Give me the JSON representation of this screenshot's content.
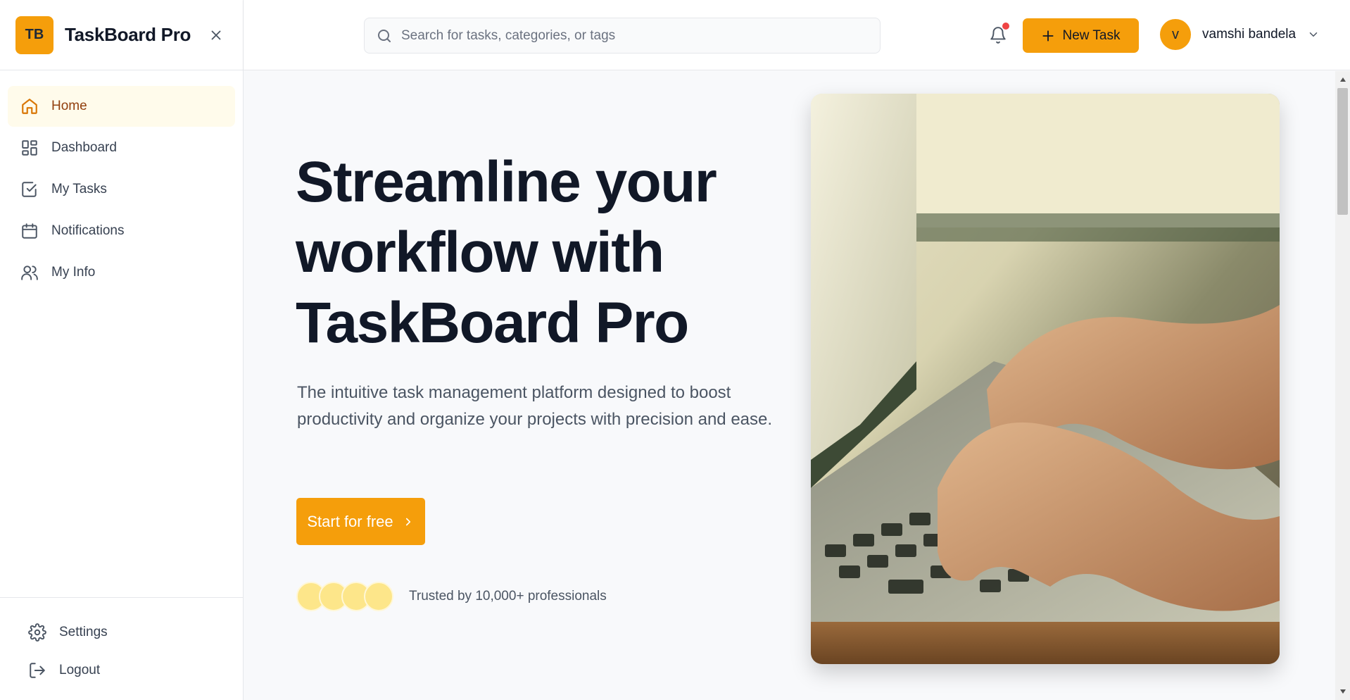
{
  "brand": {
    "logo_text": "TB",
    "name": "TaskBoard Pro"
  },
  "sidebar": {
    "items": [
      {
        "label": "Home",
        "icon": "home-icon",
        "active": true
      },
      {
        "label": "Dashboard",
        "icon": "dashboard-icon"
      },
      {
        "label": "My Tasks",
        "icon": "check-square-icon"
      },
      {
        "label": "Notifications",
        "icon": "calendar-icon"
      },
      {
        "label": "My Info",
        "icon": "users-icon"
      }
    ],
    "bottom": [
      {
        "label": "Settings",
        "icon": "gear-icon"
      },
      {
        "label": "Logout",
        "icon": "logout-icon"
      }
    ]
  },
  "header": {
    "search_placeholder": "Search for tasks, categories, or tags",
    "new_task_label": "New Task",
    "user": {
      "initial": "v",
      "name": "vamshi bandela"
    }
  },
  "hero": {
    "title": "Streamline your workflow with TaskBoard Pro",
    "subtitle": "The intuitive task management platform designed to boost productivity and organize your projects with precision and ease.",
    "cta_label": "Start for free",
    "trust_text": "Trusted by 10,000+ professionals"
  },
  "colors": {
    "accent": "#f59e0b",
    "active_bg": "#fffbeb",
    "notification_dot": "#ef4444"
  }
}
